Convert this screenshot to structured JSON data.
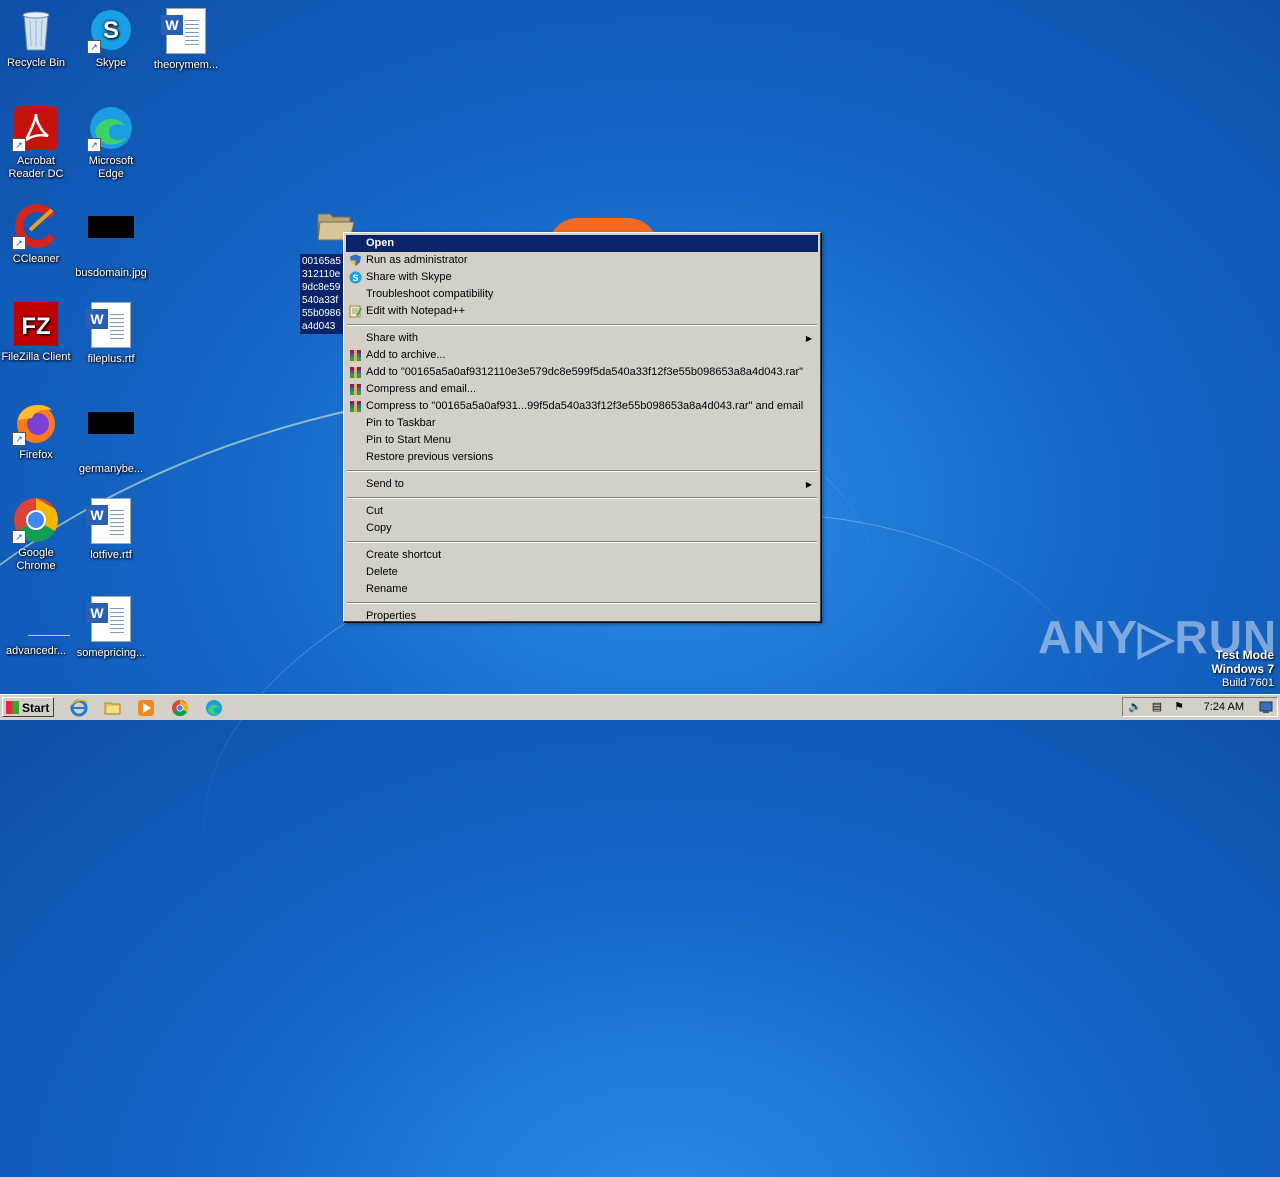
{
  "desktop": {
    "icons": [
      {
        "label": "Recycle Bin",
        "icon": "recycle-bin-icon"
      },
      {
        "label": "Skype",
        "icon": "skype-icon"
      },
      {
        "label": "theorymem...",
        "icon": "word-document-icon"
      },
      {
        "label": "Acrobat Reader DC",
        "icon": "acrobat-icon"
      },
      {
        "label": "Microsoft Edge",
        "icon": "edge-icon"
      },
      {
        "label": "CCleaner",
        "icon": "ccleaner-icon"
      },
      {
        "label": "busdomain.jpg",
        "icon": "image-file-icon"
      },
      {
        "label": "FileZilla Client",
        "icon": "filezilla-icon"
      },
      {
        "label": "fileplus.rtf",
        "icon": "word-document-icon"
      },
      {
        "label": "Firefox",
        "icon": "firefox-icon"
      },
      {
        "label": "germanybe...",
        "icon": "image-file-icon"
      },
      {
        "label": "Google Chrome",
        "icon": "chrome-icon"
      },
      {
        "label": "lotfive.rtf",
        "icon": "word-document-icon"
      },
      {
        "label": "advancedr...",
        "icon": "file-icon"
      },
      {
        "label": "somepricing...",
        "icon": "word-document-icon"
      }
    ],
    "selected_item": {
      "label_lines": [
        "00165a5",
        "312110e",
        "9dc8e59",
        "540a33f",
        "55b0986",
        "a4d043"
      ],
      "icon": "folder-icon"
    }
  },
  "context_menu": {
    "groups": [
      [
        {
          "label": "Open",
          "highlighted": true,
          "icon": ""
        },
        {
          "label": "Run as administrator",
          "icon": "uac-shield-icon"
        },
        {
          "label": "Share with Skype",
          "icon": "skype-icon"
        },
        {
          "label": "Troubleshoot compatibility",
          "icon": ""
        },
        {
          "label": "Edit with Notepad++",
          "icon": "notepadpp-icon"
        }
      ],
      [
        {
          "label": "Share with",
          "submenu": true,
          "icon": ""
        },
        {
          "label": "Add to archive...",
          "icon": "winrar-icon"
        },
        {
          "label": "Add to \"00165a5a0af9312110e3e579dc8e599f5da540a33f12f3e55b098653a8a4d043.rar\"",
          "icon": "winrar-icon"
        },
        {
          "label": "Compress and email...",
          "icon": "winrar-icon"
        },
        {
          "label": "Compress to \"00165a5a0af931...99f5da540a33f12f3e55b098653a8a4d043.rar\" and email",
          "icon": "winrar-icon"
        },
        {
          "label": "Pin to Taskbar",
          "icon": ""
        },
        {
          "label": "Pin to Start Menu",
          "icon": ""
        },
        {
          "label": "Restore previous versions",
          "icon": ""
        }
      ],
      [
        {
          "label": "Send to",
          "submenu": true,
          "icon": ""
        }
      ],
      [
        {
          "label": "Cut",
          "icon": ""
        },
        {
          "label": "Copy",
          "icon": ""
        }
      ],
      [
        {
          "label": "Create shortcut",
          "icon": ""
        },
        {
          "label": "Delete",
          "icon": ""
        },
        {
          "label": "Rename",
          "icon": ""
        }
      ],
      [
        {
          "label": "Properties",
          "icon": ""
        }
      ]
    ]
  },
  "taskbar": {
    "start_label": "Start",
    "pinned": [
      "internet-explorer-icon",
      "explorer-folder-icon",
      "media-player-icon",
      "chrome-icon",
      "edge-icon"
    ],
    "clock": "7:24 AM",
    "tray_icons": [
      "volume-icon",
      "network-icon",
      "action-center-flag-icon",
      "show-desktop-icon"
    ]
  },
  "watermark": {
    "brand": "ANY▷RUN",
    "test_mode": "Test Mode",
    "os": "Windows 7",
    "build": "Build 7601"
  }
}
